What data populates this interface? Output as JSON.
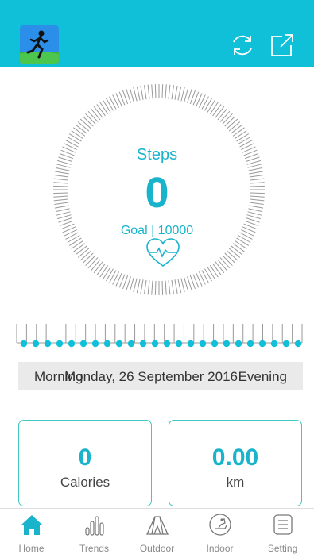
{
  "colors": {
    "accent": "#10c0d8",
    "text_accent": "#19b4cc",
    "card_border": "#3fc9c0",
    "tick": "#999999",
    "date_bar_bg": "#eaeaea"
  },
  "header": {
    "avatar_icon": "runner-avatar-icon",
    "refresh_icon": "refresh-icon",
    "share_icon": "share-icon"
  },
  "steps": {
    "label": "Steps",
    "value": "0",
    "goal_label": "Goal | 10000",
    "progress": 0
  },
  "timeline": {
    "start_label": "Morning",
    "date": "Monday, 26 September 2016",
    "end_label": "Evening"
  },
  "stats": {
    "calories_value": "0",
    "calories_unit": "Calories",
    "distance_value": "0.00",
    "distance_unit": "km"
  },
  "nav": {
    "items": [
      {
        "label": "Home",
        "icon": "home-icon",
        "active": true
      },
      {
        "label": "Trends",
        "icon": "trends-icon",
        "active": false
      },
      {
        "label": "Outdoor",
        "icon": "tent-icon",
        "active": false
      },
      {
        "label": "Indoor",
        "icon": "treadmill-icon",
        "active": false
      },
      {
        "label": "Setting",
        "icon": "settings-list-icon",
        "active": false
      }
    ]
  }
}
